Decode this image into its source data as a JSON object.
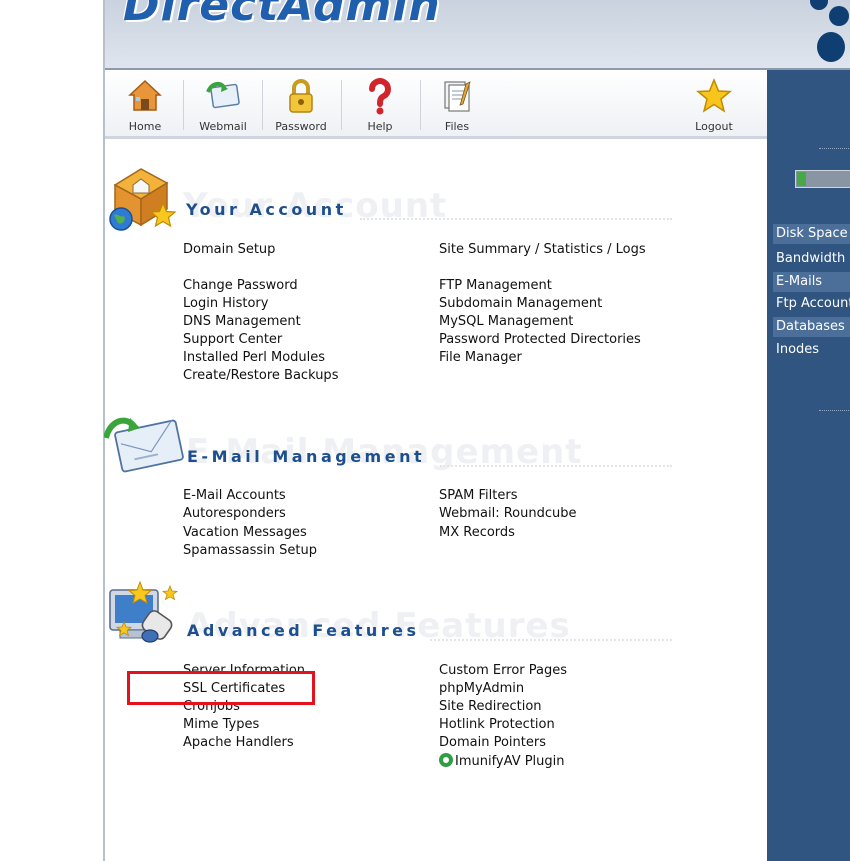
{
  "app": {
    "logo_text": "DirectAdmin"
  },
  "toolbar": {
    "items": [
      {
        "label": "Home",
        "icon": "home-icon"
      },
      {
        "label": "Webmail",
        "icon": "webmail-icon"
      },
      {
        "label": "Password",
        "icon": "lock-icon"
      },
      {
        "label": "Help",
        "icon": "question-icon"
      },
      {
        "label": "Files",
        "icon": "files-icon"
      },
      {
        "label": "Logout",
        "icon": "star-icon"
      }
    ]
  },
  "sidebar": {
    "items": [
      "Disk Space",
      "Bandwidth",
      "E-Mails",
      "Ftp Accounts",
      "Databases",
      "Inodes"
    ],
    "disk_progress_fraction": 0.15
  },
  "sections": {
    "account": {
      "title": "Your Account",
      "left": [
        "Domain Setup",
        "Change Password",
        "Login History",
        "DNS Management",
        "Support Center",
        "Installed Perl Modules",
        "Create/Restore Backups"
      ],
      "right": [
        "Site Summary / Statistics / Logs",
        "FTP Management",
        "Subdomain Management",
        "MySQL Management",
        "Password Protected Directories",
        "File Manager"
      ]
    },
    "email": {
      "title": "E-Mail Management",
      "left": [
        "E-Mail Accounts",
        "Autoresponders",
        "Vacation Messages",
        "Spamassassin Setup"
      ],
      "right": [
        "SPAM Filters",
        "Webmail: Roundcube",
        "MX Records"
      ]
    },
    "advanced": {
      "title": "Advanced Features",
      "left": [
        "Server Information",
        "SSL Certificates",
        "Cronjobs",
        "Mime Types",
        "Apache Handlers"
      ],
      "right": [
        "Custom Error Pages",
        "phpMyAdmin",
        "Site Redirection",
        "Hotlink Protection",
        "Domain Pointers",
        "ImunifyAV Plugin"
      ]
    }
  },
  "colors": {
    "accent": "#1d4f8f",
    "sidebar": "#2f5580",
    "highlight": "#e3131e"
  }
}
